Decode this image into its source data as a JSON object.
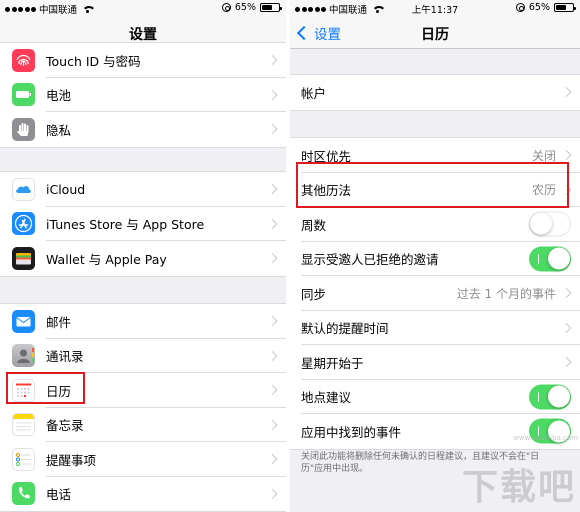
{
  "left": {
    "status": {
      "carrier": "中国联通",
      "battery": "65%",
      "battery_level": 0.65
    },
    "nav": {
      "title": "设置"
    },
    "groups": [
      {
        "items": [
          {
            "label": "Touch ID 与密码",
            "icon": "fingerprint-icon",
            "color": "#ff3b58"
          },
          {
            "label": "电池",
            "icon": "battery-icon",
            "color": "#4cd964"
          },
          {
            "label": "隐私",
            "icon": "hand-icon",
            "color": "#8e8e93"
          }
        ]
      },
      {
        "items": [
          {
            "label": "iCloud",
            "icon": "cloud-icon",
            "color": "#ffffff"
          },
          {
            "label": "iTunes Store 与 App Store",
            "icon": "app-store-icon",
            "color": "#1a8cff"
          },
          {
            "label": "Wallet 与 Apple Pay",
            "icon": "wallet-icon",
            "color": "#1c1c1e"
          }
        ]
      },
      {
        "items": [
          {
            "label": "邮件",
            "icon": "mail-icon",
            "color": "#1a8cff"
          },
          {
            "label": "通讯录",
            "icon": "contacts-icon",
            "color": "#a4a4a8"
          },
          {
            "label": "日历",
            "icon": "calendar-icon",
            "color": "#ffffff"
          },
          {
            "label": "备忘录",
            "icon": "notes-icon",
            "color": "#ffd60a"
          },
          {
            "label": "提醒事项",
            "icon": "reminders-icon",
            "color": "#ffffff"
          },
          {
            "label": "电话",
            "icon": "phone-icon",
            "color": "#4cd964"
          }
        ]
      }
    ]
  },
  "right": {
    "status": {
      "carrier": "中国联通",
      "time": "上午11:37",
      "battery": "65%",
      "battery_level": 0.65
    },
    "nav": {
      "back": "设置",
      "title": "日历"
    },
    "account_group": [
      {
        "label": "帐户"
      }
    ],
    "settings_group": [
      {
        "label": "时区优先",
        "value": "关闭",
        "type": "value"
      },
      {
        "label": "其他历法",
        "value": "农历",
        "type": "value"
      },
      {
        "label": "周数",
        "type": "toggle",
        "on": false
      },
      {
        "label": "显示受邀人已拒绝的邀请",
        "type": "toggle",
        "on": true
      },
      {
        "label": "同步",
        "value": "过去 1 个月的事件",
        "type": "value"
      },
      {
        "label": "默认的提醒时间",
        "type": "chevron"
      },
      {
        "label": "星期开始于",
        "type": "chevron"
      },
      {
        "label": "地点建议",
        "type": "toggle",
        "on": true
      },
      {
        "label": "应用中找到的事件",
        "type": "toggle",
        "on": true
      }
    ],
    "footer": "关闭此功能将删除任何未确认的日程建议，且建议不会在\"日历\"应用中出现。"
  },
  "watermark": {
    "text": "下载吧",
    "url": "www.xiazaiba.com"
  },
  "colors": {
    "accent": "#0a7aff",
    "toggle_on": "#4cd964",
    "highlight": "#e0181f"
  }
}
